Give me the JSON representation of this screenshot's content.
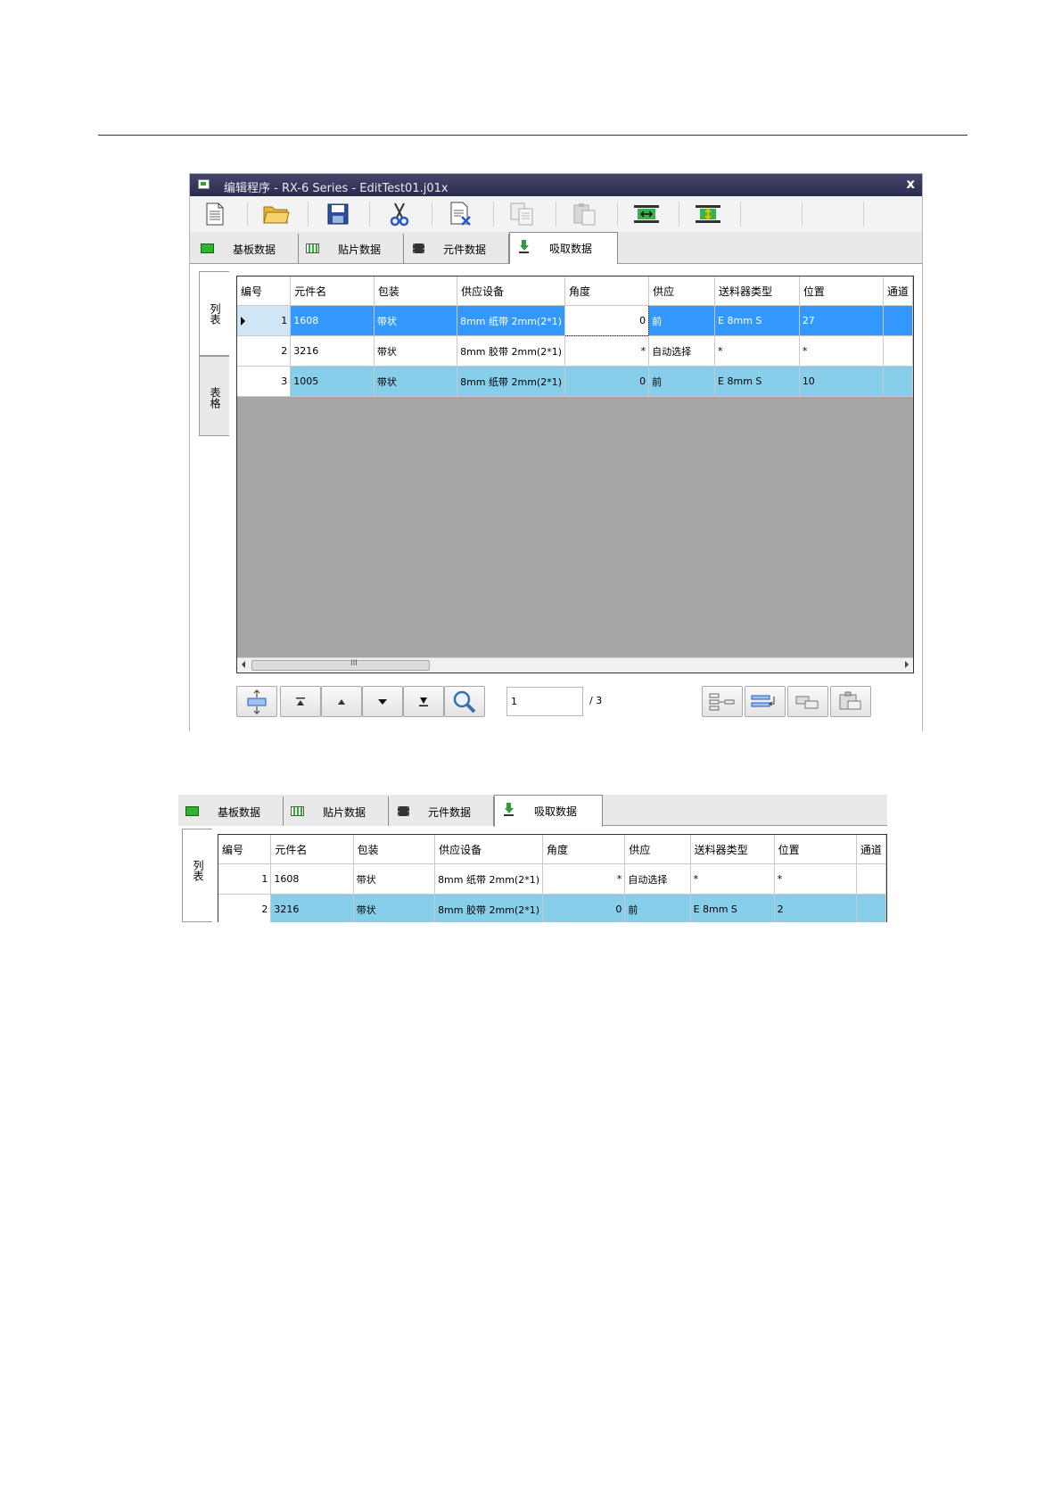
{
  "window": {
    "title": "编辑程序 - RX-6 Series - EditTest01.j01x",
    "close": "x"
  },
  "toolbar": {
    "icons": [
      "new-file-icon",
      "open-folder-icon",
      "save-icon",
      "cut-icon",
      "delete-file-icon",
      "copy-icon",
      "paste-icon",
      "board-move-icon",
      "board-resize-icon"
    ]
  },
  "tabs": [
    {
      "label": "基板数据",
      "icon": "board-icon",
      "color": "#2db52d"
    },
    {
      "label": "贴片数据",
      "icon": "mount-grid-icon"
    },
    {
      "label": "元件数据",
      "icon": "chip-icon"
    },
    {
      "label": "吸取数据",
      "icon": "nozzle-icon",
      "color": "#2e9e3a"
    }
  ],
  "side_tabs": {
    "list": "列表",
    "table": "表格"
  },
  "grid": {
    "columns": [
      "编号",
      "元件名",
      "包装",
      "供应设备",
      "角度",
      "供应",
      "送料器类型",
      "位置",
      "通道"
    ],
    "rows": [
      {
        "no": "1",
        "name": "1608",
        "pack": "带状",
        "device": "8mm 纸带 2mm(2*1)",
        "angle": "0",
        "supply": "前",
        "feeder": "E 8mm S",
        "pos": "27",
        "ch": ""
      },
      {
        "no": "2",
        "name": "3216",
        "pack": "带状",
        "device": "8mm 胶带 2mm(2*1)",
        "angle": "*",
        "supply": "自动选择",
        "feeder": "*",
        "pos": "*",
        "ch": ""
      },
      {
        "no": "3",
        "name": "1005",
        "pack": "带状",
        "device": "8mm 纸带 2mm(2*1)",
        "angle": "0",
        "supply": "前",
        "feeder": "E 8mm S",
        "pos": "10",
        "ch": ""
      }
    ],
    "scroll_grip": "III"
  },
  "nav": {
    "page": "1",
    "total": "/ 3"
  },
  "panel2": {
    "rows": [
      {
        "no": "1",
        "name": "1608",
        "pack": "带状",
        "device": "8mm 纸带 2mm(2*1)",
        "angle": "*",
        "supply": "自动选择",
        "feeder": "*",
        "pos": "*",
        "ch": ""
      },
      {
        "no": "2",
        "name": "3216",
        "pack": "带状",
        "device": "8mm 胶带 2mm(2*1)",
        "angle": "0",
        "supply": "前",
        "feeder": "E 8mm S",
        "pos": "2",
        "ch": ""
      }
    ]
  },
  "colors": {
    "selected_row": "#3399ff",
    "highlight_row": "#87ceea",
    "title_bar": "#2b2d4e"
  }
}
